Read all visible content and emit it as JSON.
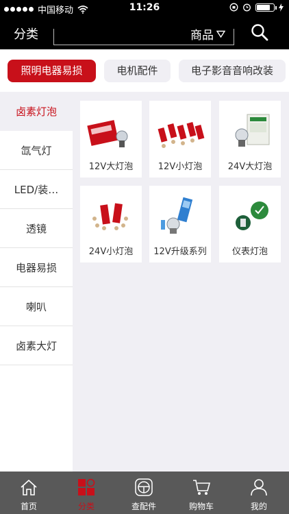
{
  "status_bar": {
    "carrier": "中国移动",
    "time": "11:26",
    "battery_level": 0.8
  },
  "header": {
    "title": "分类",
    "search_scope": "商品"
  },
  "category_tabs": [
    {
      "label": "照明电器易损",
      "active": true
    },
    {
      "label": "电机配件",
      "active": false
    },
    {
      "label": "电子影音音响改装",
      "active": false
    }
  ],
  "sidebar": {
    "items": [
      {
        "label": "卤素灯泡",
        "active": true
      },
      {
        "label": "氙气灯",
        "active": false
      },
      {
        "label": "LED/装…",
        "active": false
      },
      {
        "label": "透镜",
        "active": false
      },
      {
        "label": "电器易损",
        "active": false
      },
      {
        "label": "喇叭",
        "active": false
      },
      {
        "label": "卤素大灯",
        "active": false
      }
    ]
  },
  "products": [
    {
      "label": "12V大灯泡"
    },
    {
      "label": "12V小灯泡"
    },
    {
      "label": "24V大灯泡"
    },
    {
      "label": "24V小灯泡"
    },
    {
      "label": "12V升级系列"
    },
    {
      "label": "仪表灯泡"
    }
  ],
  "tab_bar": [
    {
      "label": "首页",
      "icon": "home-icon",
      "active": false
    },
    {
      "label": "分类",
      "icon": "category-icon",
      "active": true
    },
    {
      "label": "查配件",
      "icon": "steering-wheel-icon",
      "active": false
    },
    {
      "label": "购物车",
      "icon": "cart-icon",
      "active": false
    },
    {
      "label": "我的",
      "icon": "user-icon",
      "active": false
    }
  ],
  "colors": {
    "accent": "#c8101a",
    "header_bg": "#000000",
    "tabbar_bg": "#595959",
    "page_bg": "#f0eff4"
  }
}
